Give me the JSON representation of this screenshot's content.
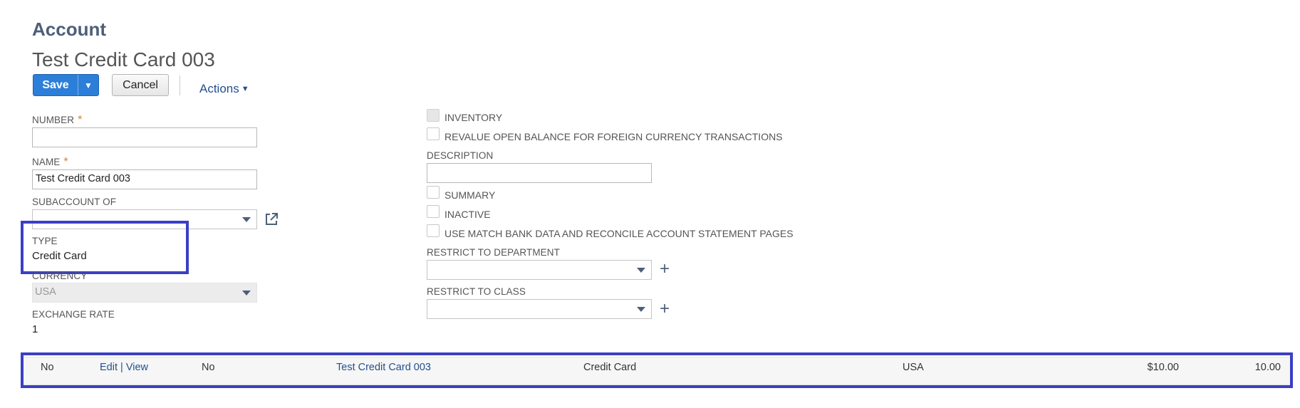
{
  "page": {
    "heading": "Account",
    "record_title": "Test Credit Card 003"
  },
  "toolbar": {
    "save_label": "Save",
    "cancel_label": "Cancel",
    "actions_label": "Actions"
  },
  "form": {
    "number": {
      "label": "NUMBER",
      "value": ""
    },
    "name": {
      "label": "NAME",
      "value": "Test Credit Card 003"
    },
    "subaccount_of": {
      "label": "SUBACCOUNT OF",
      "value": ""
    },
    "type": {
      "label": "TYPE",
      "value": "Credit Card"
    },
    "currency": {
      "label": "CURRENCY",
      "value": "USA"
    },
    "exchange_rate": {
      "label": "EXCHANGE RATE",
      "value": "1"
    },
    "inventory": {
      "label": "INVENTORY",
      "checked": false
    },
    "revalue": {
      "label": "REVALUE OPEN BALANCE FOR FOREIGN CURRENCY TRANSACTIONS",
      "checked": false
    },
    "description": {
      "label": "DESCRIPTION",
      "value": ""
    },
    "summary": {
      "label": "SUMMARY",
      "checked": false
    },
    "inactive": {
      "label": "INACTIVE",
      "checked": false
    },
    "match_bank": {
      "label": "USE MATCH BANK DATA AND RECONCILE ACCOUNT STATEMENT PAGES",
      "checked": false
    },
    "restrict_department": {
      "label": "RESTRICT TO DEPARTMENT",
      "value": ""
    },
    "restrict_class": {
      "label": "RESTRICT TO CLASS",
      "value": ""
    }
  },
  "list_row": {
    "col1": "No",
    "edit": "Edit",
    "separator": "|",
    "view": "View",
    "col3": "No",
    "name": "Test Credit Card 003",
    "type": "Credit Card",
    "currency": "USA",
    "amount": "$10.00",
    "balance": "10.00"
  },
  "colors": {
    "accent": "#2b7fd9",
    "highlight": "#3b3fc4",
    "link": "#24508f"
  }
}
